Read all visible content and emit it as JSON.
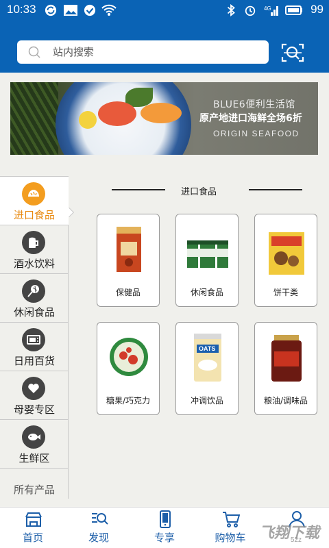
{
  "status_bar": {
    "time": "10:33",
    "battery_percent": "99",
    "icons": [
      "sync-icon",
      "image-icon",
      "check-circle-icon",
      "wifi-icon",
      "bluetooth-icon",
      "alarm-icon",
      "signal-4g-icon",
      "battery-icon"
    ]
  },
  "header": {
    "search_placeholder": "站内搜索",
    "scan_icon": "scan-icon",
    "accent_color": "#0a63b5"
  },
  "banner": {
    "line1": "BLUE6便利生活馆",
    "line2": "原产地进口海鲜全场6折",
    "line3": "ORIGIN   SEAFOOD"
  },
  "sidebar": {
    "items": [
      {
        "label": "进口食品",
        "icon": "bread-icon",
        "active": true
      },
      {
        "label": "酒水饮料",
        "icon": "beer-mug-icon",
        "active": false
      },
      {
        "label": "休闲食品",
        "icon": "lollipop-icon",
        "active": false
      },
      {
        "label": "日用百货",
        "icon": "microwave-icon",
        "active": false
      },
      {
        "label": "母婴专区",
        "icon": "heart-icon",
        "active": false
      },
      {
        "label": "生鲜区",
        "icon": "fish-icon",
        "active": false
      }
    ],
    "all_label": "所有产品",
    "active_color": "#f39d1f"
  },
  "content": {
    "section_title": "进口食品",
    "categories": [
      {
        "name": "保健品"
      },
      {
        "name": "休闲食品"
      },
      {
        "name": "饼干类"
      },
      {
        "name": "糖果/巧克力"
      },
      {
        "name": "冲调饮品"
      },
      {
        "name": "粮油/调味品"
      }
    ]
  },
  "bottom_nav": {
    "items": [
      {
        "label": "首页",
        "icon": "store-icon"
      },
      {
        "label": "发现",
        "icon": "discover-search-icon"
      },
      {
        "label": "专享",
        "icon": "phone-icon"
      },
      {
        "label": "购物车",
        "icon": "cart-icon"
      },
      {
        "label": "",
        "icon": "user-icon"
      }
    ],
    "watermark": "飞翔下载",
    "watermark_sub": "52z"
  }
}
